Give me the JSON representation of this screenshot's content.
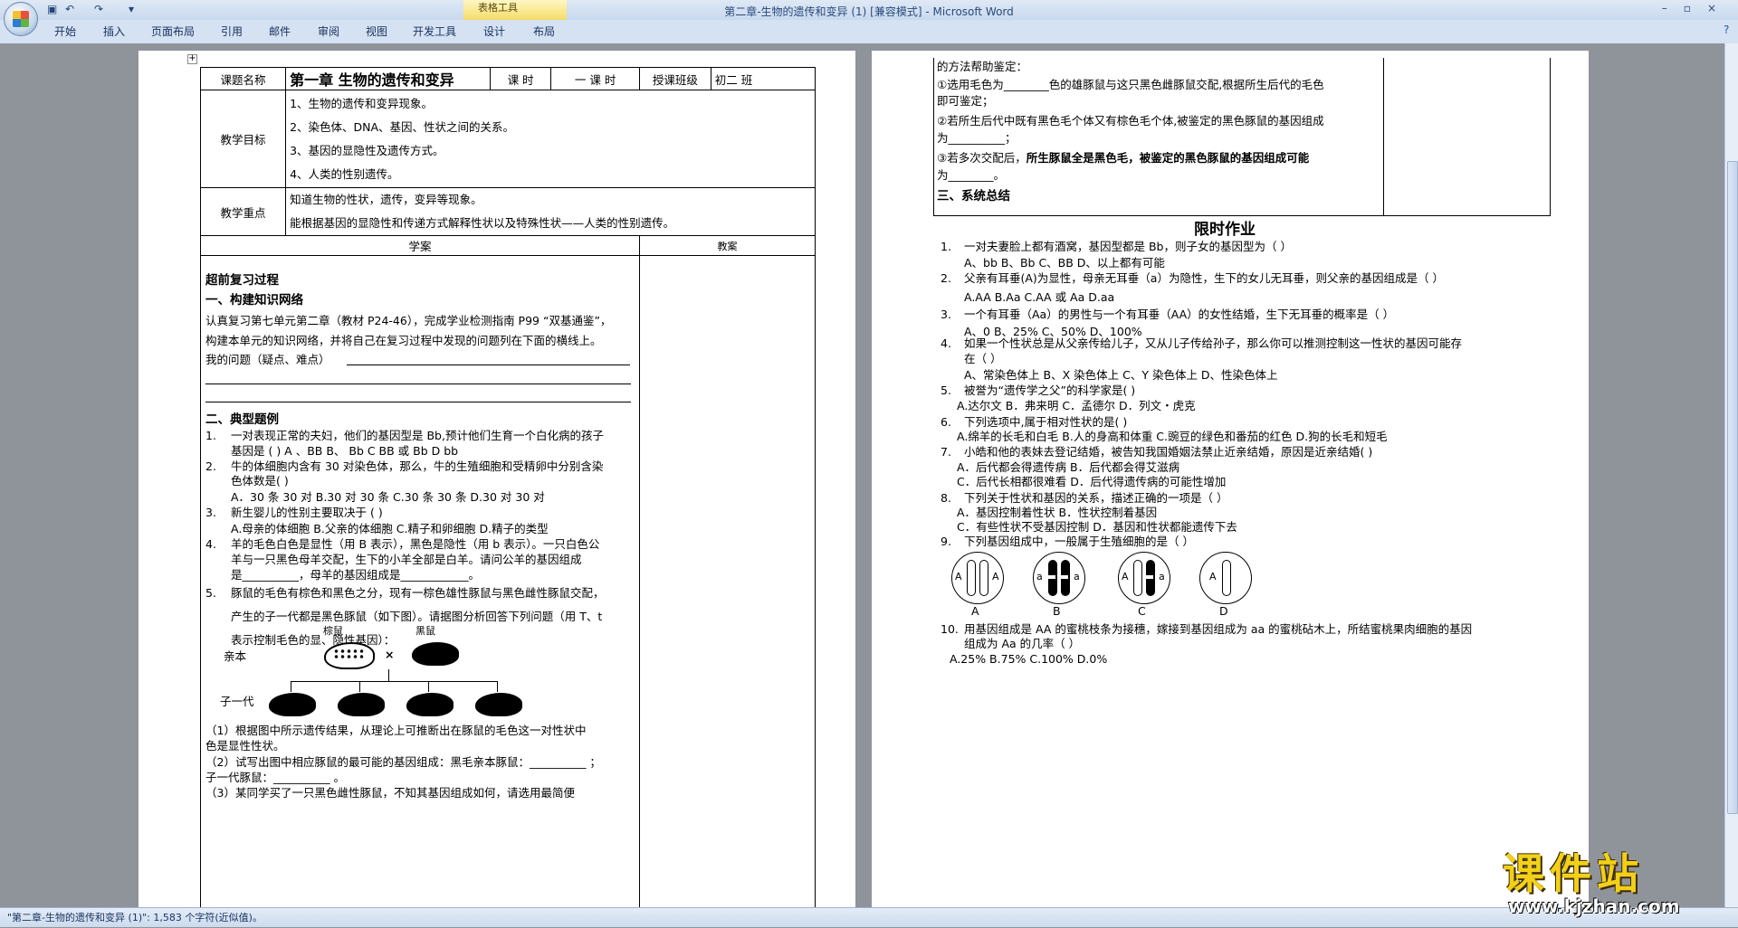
{
  "window": {
    "title": "第二章-生物的遗传和变异 (1) [兼容模式] - Microsoft Word",
    "context_tab_group": "表格工具",
    "controls": [
      "–",
      "▫",
      "×"
    ]
  },
  "ribbon_tabs": [
    "开始",
    "插入",
    "页面布局",
    "引用",
    "邮件",
    "审阅",
    "视图",
    "开发工具",
    "设计",
    "布局"
  ],
  "status_bar": "\"第二章-生物的遗传和变异 (1)\": 1,583 个字符(近似值)。",
  "watermark": {
    "text": "课件站",
    "url": "www.kjzhan.com"
  },
  "page1": {
    "table": {
      "course_name_label": "课题名称",
      "course_name": "第一章 生物的遗传和变异",
      "period_label": "课  时",
      "period_value": "一 课 时",
      "class_label": "授课班级",
      "class_value": "初二          班",
      "goals_label": "教学目标",
      "goals": [
        "1、生物的遗传和变异现象。",
        "2、染色体、DNA、基因、性状之间的关系。",
        "3、基因的显隐性及遗传方式。",
        "4、人类的性别遗传。"
      ],
      "focus_label": "教学重点",
      "focus": [
        "知道生物的性状，遗传，变异等现象。",
        "能根据基因的显隐性和传递方式解释性状以及特殊性状——人类的性别遗传。"
      ],
      "xuean_label": "学案",
      "jiaoan_label": "教案"
    },
    "review_title": "超前复习过程",
    "section1": "一、构建知识网络",
    "para1": "认真复习第七单元第二章（教材 P24-46），完成学业检测指南 P99 “双基通鉴”，",
    "para2": "构建本单元的知识网络，并将自己在复习过程中发现的问题列在下面的横线上。",
    "my_questions": "我的问题（疑点、难点）",
    "section2": "二、典型题例",
    "q1a": "一对表现正常的夫妇，他们的基因型是 Bb,预计他们生育一个白化病的孩子",
    "q1b": "基因是    (      )    A 、BB        B、 Bb      C   BB 或 Bb      D    bb",
    "q2a": "牛的体细胞内含有 30 对染色体，那么，牛的生殖细胞和受精卵中分别含染",
    "q2b": "色体数是(        )",
    "q2c": "A．30 条 30 对          B.30 对 30 条     C.30 条 30 条              D.30 对 30 对",
    "q3a": "新生婴儿的性别主要取决于 (         )",
    "q3b": "A.母亲的体细胞     B.父亲的体细胞       C.精子和卵细胞      D.精子的类型",
    "q4a": "羊的毛色白色是显性（用 B 表示），黑色是隐性（用 b 表示）。一只白色公",
    "q4b": "羊与一只黑色母羊交配，生下的小羊全部是白羊。请问公羊的基因组成",
    "q4c": "是__________，母羊的基因组成是____________。",
    "q5a": "豚鼠的毛色有棕色和黑色之分，现有一棕色雄性豚鼠与黑色雌性豚鼠交配，",
    "q5b": "产生的子一代都是黑色豚鼠（如下图）。请据图分析回答下列问题（用 T、t",
    "q5c": "表示控制毛色的显、隐性基因）：",
    "label_brown": "棕鼠",
    "label_black": "黑鼠",
    "parents": "亲本",
    "cross": "×",
    "offspring": "子一代",
    "sub1a": "（1）根据图中所示遗传结果，从理论上可推断出在豚鼠的毛色这一对性状中",
    "sub1b": "色是显性性状。",
    "sub2a": "（2）试写出图中相应豚鼠的最可能的基因组成：黑毛亲本豚鼠：__________  ；",
    "sub2b": "子一代豚鼠：__________  。",
    "sub3": "（3）某同学买了一只黑色雌性豚鼠，不知其基因组成如何，请选用最简便"
  },
  "page2": {
    "cont1": "的方法帮助鉴定：",
    "cont2": "①选用毛色为________色的雄豚鼠与这只黑色雌豚鼠交配,根据所生后代的毛色",
    "cont3": "即可鉴定；",
    "cont4": "②若所生后代中既有黑色毛个体又有棕色毛个体,被鉴定的黑色豚鼠的基因组成",
    "cont5": "为__________；",
    "cont6a": "③若多次交配后，",
    "cont6b": "所生豚鼠全是黑色毛，被鉴定的黑色豚鼠的基因组成可能",
    "cont7": "为________。",
    "summary": "三、系统总结",
    "homework_title": "限时作业",
    "hw": [
      {
        "n": "1.",
        "q": "一对夫妻脸上都有酒窝，基因型都是 Bb，则子女的基因型为（     ）",
        "opts": "A、bb                  B、Bb            C、BB                     D、以上都有可能"
      },
      {
        "n": "2.",
        "q": "父亲有耳垂(A)为显性，母亲无耳垂（a）为隐性，生下的女儿无耳垂，则父亲的基因组成是（     ）",
        "opts": "A.AA     B.Aa      C.AA 或 Aa     D.aa"
      },
      {
        "n": "3.",
        "q": "一个有耳垂（Aa）的男性与一个有耳垂（AA）的女性结婚，生下无耳垂的概率是（     ）",
        "opts": "A、0         B、25%            C、50%           D、100%"
      },
      {
        "n": "4.",
        "q": "如果一个性状总是从父亲传给儿子，又从儿子传给孙子，那么你可以推测控制这一性状的基因可能存",
        "q2": "在（      ）",
        "opts": "A、常染色体上     B、X 染色体上       C、Y 染色体上       D、性染色体上"
      },
      {
        "n": "5.",
        "q": "被誉为“遗传学之父”的科学家是(        )",
        "opts": "A.达尔文                B．弗来明              C．孟德尔           D．列文・虎克"
      },
      {
        "n": "6.",
        "q": "下列选项中,属于相对性状的是(       )",
        "opts": "A.绵羊的长毛和白毛  B.人的身高和体重  C.豌豆的绿色和番茄的红色   D.狗的长毛和短毛"
      },
      {
        "n": "7.",
        "q": "小皓和他的表妹去登记结婚，被告知我国婚姻法禁止近亲结婚，原因是近亲结婚(     )",
        "opts": "A．后代都会得遗传病      B．后代都会得艾滋病",
        "opts2": "C．后代长相都很难看      D．后代得遗传病的可能性增加"
      },
      {
        "n": "8.",
        "q": "下列关于性状和基因的关系，描述正确的一项是（      ）",
        "opts": "A．基因控制着性状             B．性状控制着基因",
        "opts2": "C．有些性状不受基因控制    D．基因和性状都能遗传下去"
      },
      {
        "n": "9.",
        "q": "下列基因组成中，一般属于生殖细胞的是（      ）",
        "opts": ""
      },
      {
        "n": "10.",
        "q": "用基因组成是 AA 的蜜桃枝条为接穗，嫁接到基因组成为 aa 的蜜桃砧木上，所结蜜桃果肉细胞的基因",
        "q2": "组成为 Aa 的几率（     ）",
        "opts": "A.25%                    B.75%                     C.100%                  D.0%"
      }
    ],
    "cells": [
      {
        "label": "A",
        "left": "A",
        "right": "A"
      },
      {
        "label": "B",
        "left": "a",
        "right": "a"
      },
      {
        "label": "C",
        "left": "A",
        "right": "a"
      },
      {
        "label": "D",
        "left": "A",
        "right": ""
      }
    ]
  }
}
